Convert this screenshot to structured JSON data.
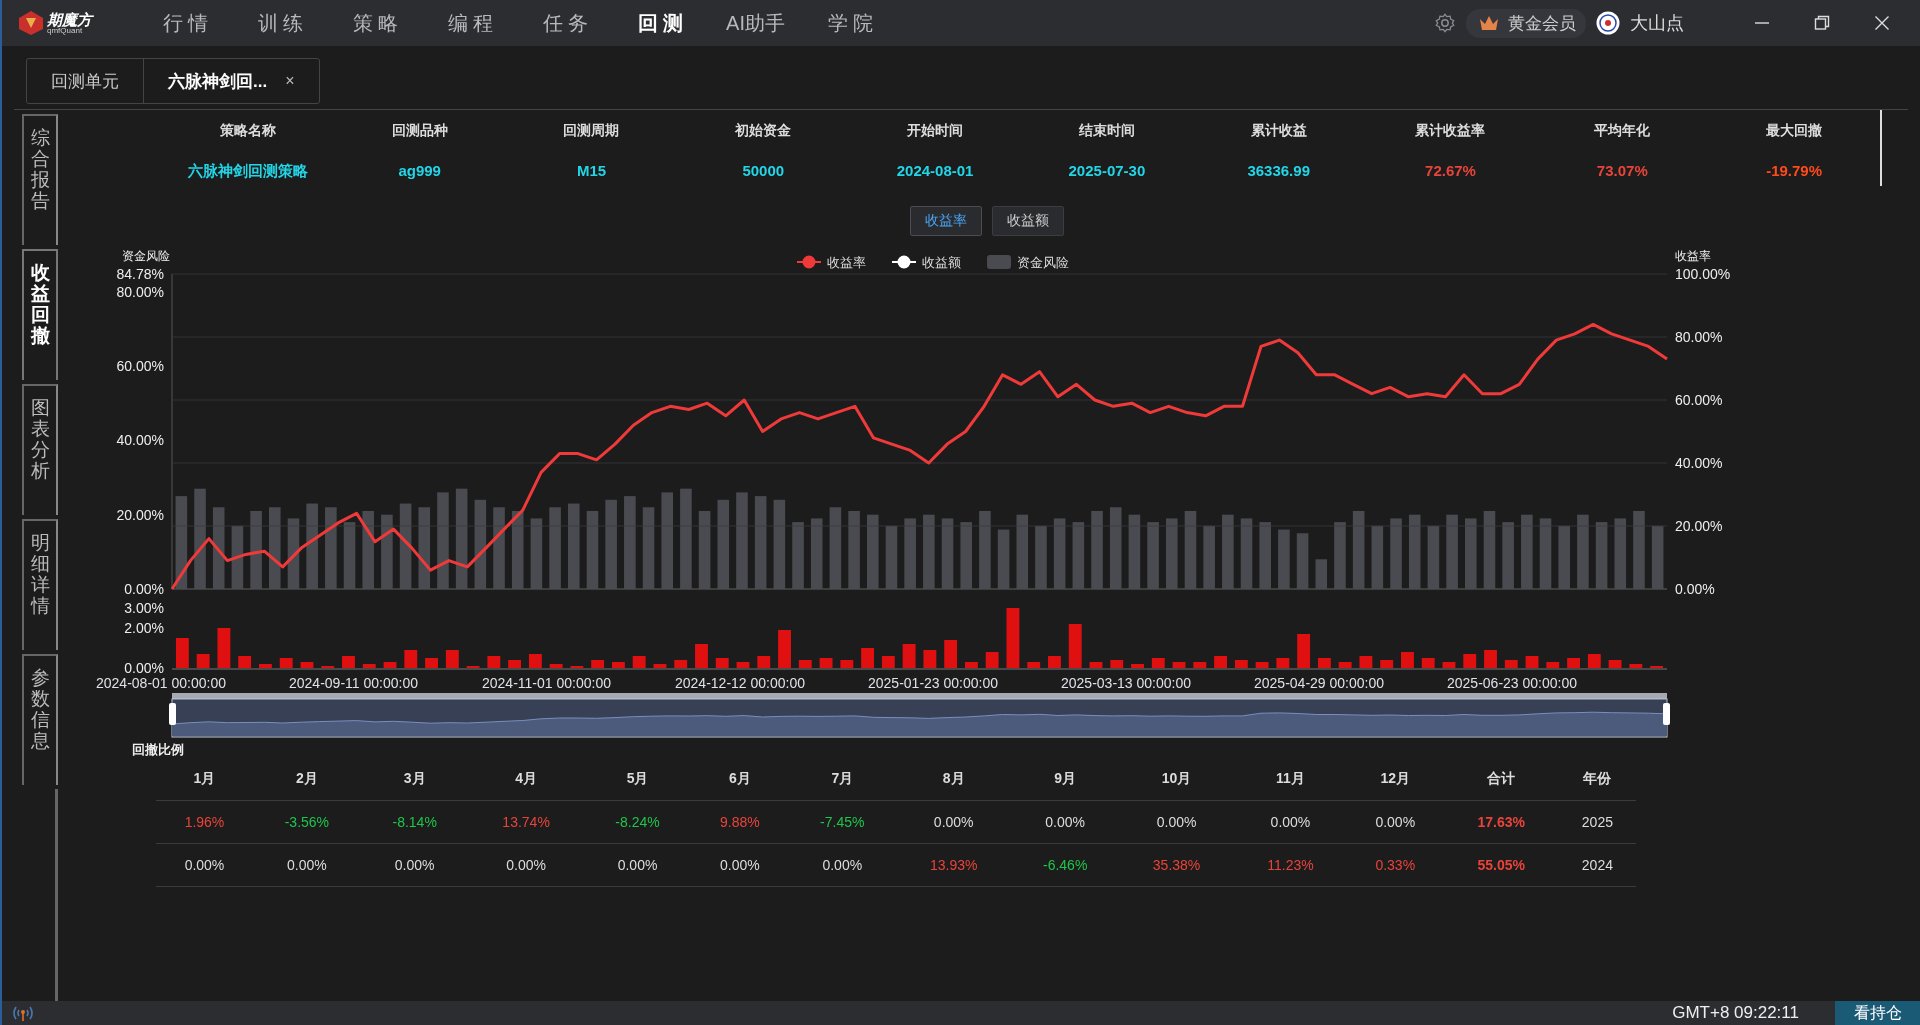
{
  "app": {
    "logo_text": "期魔方",
    "logo_sub": "qmfQuant"
  },
  "nav": [
    {
      "label": "行 情",
      "selected": false
    },
    {
      "label": "训 练",
      "selected": false
    },
    {
      "label": "策 略",
      "selected": false
    },
    {
      "label": "编 程",
      "selected": false
    },
    {
      "label": "任 务",
      "selected": false
    },
    {
      "label": "回 测",
      "selected": true
    },
    {
      "label": "AI助手",
      "selected": false
    },
    {
      "label": "学 院",
      "selected": false
    }
  ],
  "user": {
    "membership": "黄金会员",
    "name": "大山点"
  },
  "doc_tabs": [
    {
      "label": "回测单元",
      "selected": false
    },
    {
      "label": "六脉神剑回...",
      "selected": true,
      "close": "×"
    }
  ],
  "side_tabs": [
    {
      "label": "综合报告",
      "selected": false
    },
    {
      "label": "收益回撤",
      "selected": true
    },
    {
      "label": "图表分析",
      "selected": false
    },
    {
      "label": "明细详情",
      "selected": false
    },
    {
      "label": "参数信息",
      "selected": false
    }
  ],
  "summary": [
    {
      "label": "策略名称",
      "value": "六脉神剑回测策略",
      "color": "#22d6e8"
    },
    {
      "label": "回测品种",
      "value": "ag999",
      "color": "#22d6e8"
    },
    {
      "label": "回测周期",
      "value": "M15",
      "color": "#22d6e8"
    },
    {
      "label": "初始资金",
      "value": "50000",
      "color": "#22d6e8"
    },
    {
      "label": "开始时间",
      "value": "2024-08-01",
      "color": "#22d6e8"
    },
    {
      "label": "结束时间",
      "value": "2025-07-30",
      "color": "#22d6e8"
    },
    {
      "label": "累计收益",
      "value": "36336.99",
      "color": "#22d6e8"
    },
    {
      "label": "累计收益率",
      "value": "72.67%",
      "color": "#e8443a"
    },
    {
      "label": "平均年化",
      "value": "73.07%",
      "color": "#e8443a"
    },
    {
      "label": "最大回撤",
      "value": "-19.79%",
      "color": "#ff4a1c"
    }
  ],
  "toggles": [
    {
      "label": "收益率",
      "selected": true
    },
    {
      "label": "收益额",
      "selected": false
    }
  ],
  "legend_extra": [
    {
      "label": "收益额",
      "color": "#ffffff"
    }
  ],
  "return_chart": {
    "chart_data": {
      "type": "line",
      "ylabel": "收益率",
      "grid": true,
      "ylim": [
        0,
        100
      ],
      "yticks": [
        {
          "value": 0,
          "label": "0.00%"
        },
        {
          "value": 20,
          "label": "20.00%"
        },
        {
          "value": 40,
          "label": "40.00%"
        },
        {
          "value": 60,
          "label": "60.00%"
        },
        {
          "value": 80,
          "label": "80.00%"
        },
        {
          "value": 100,
          "label": "100.00%"
        }
      ],
      "series": [
        {
          "name": "收益率",
          "color": "#f03a3a",
          "values": [
            0,
            9,
            16,
            9,
            11,
            12,
            7,
            13,
            17,
            21,
            24,
            15,
            19,
            13,
            6,
            9,
            7,
            13,
            19,
            25,
            37,
            43,
            43,
            41,
            46,
            52,
            56,
            58,
            57,
            59,
            55,
            60,
            50,
            54,
            56,
            54,
            56,
            58,
            48,
            46,
            44,
            40,
            46,
            50,
            58,
            68,
            65,
            69,
            61,
            65,
            60,
            58,
            59,
            56,
            58,
            56,
            55,
            58,
            58,
            77,
            79,
            75,
            68,
            68,
            65,
            62,
            64,
            61,
            62,
            61,
            68,
            62,
            62,
            65,
            73,
            79,
            81,
            84,
            81,
            79,
            77,
            73
          ]
        }
      ]
    }
  },
  "risk_chart": {
    "chart_data": {
      "type": "bar",
      "ylabel": "资金风险",
      "ylim": [
        0,
        84.78
      ],
      "yticks": [
        {
          "value": 0,
          "label": "0.00%"
        },
        {
          "value": 20,
          "label": "20.00%"
        },
        {
          "value": 40,
          "label": "40.00%"
        },
        {
          "value": 60,
          "label": "60.00%"
        },
        {
          "value": 80,
          "label": "80.00%"
        },
        {
          "value": 84.78,
          "label": "84.78%"
        }
      ],
      "series": [
        {
          "name": "资金风险",
          "color": "#4a4b50",
          "values": [
            25,
            27,
            22,
            17,
            21,
            22,
            19,
            23,
            22,
            18,
            21,
            20,
            23,
            22,
            26,
            27,
            24,
            22,
            21,
            19,
            22,
            23,
            21,
            24,
            25,
            22,
            26,
            27,
            21,
            24,
            26,
            25,
            24,
            18,
            19,
            22,
            21,
            20,
            17,
            19,
            20,
            19,
            18,
            21,
            16,
            20,
            17,
            19,
            18,
            21,
            22,
            20,
            18,
            19,
            21,
            17,
            20,
            19,
            18,
            16,
            15,
            8,
            18,
            21,
            17,
            19,
            20,
            17,
            20,
            19,
            21,
            18,
            20,
            19,
            17,
            20,
            18,
            19,
            21,
            17
          ]
        }
      ]
    }
  },
  "drawdown_chart": {
    "chart_data": {
      "type": "bar",
      "ylim": [
        0,
        3
      ],
      "yticks": [
        {
          "value": 0,
          "label": "0.00%"
        },
        {
          "value": 2,
          "label": "2.00%"
        },
        {
          "value": 3,
          "label": "3.00%"
        }
      ],
      "series": [
        {
          "color": "#e01010",
          "values": [
            1.5,
            0.7,
            2.0,
            0.6,
            0.2,
            0.5,
            0.3,
            0.1,
            0.6,
            0.2,
            0.3,
            0.9,
            0.5,
            0.9,
            0.1,
            0.6,
            0.4,
            0.7,
            0.2,
            0.1,
            0.4,
            0.3,
            0.6,
            0.2,
            0.4,
            1.2,
            0.5,
            0.3,
            0.6,
            1.9,
            0.4,
            0.5,
            0.4,
            1.0,
            0.6,
            1.2,
            0.9,
            1.4,
            0.3,
            0.8,
            3.0,
            0.3,
            0.6,
            2.2,
            0.3,
            0.4,
            0.2,
            0.5,
            0.3,
            0.3,
            0.6,
            0.4,
            0.3,
            0.5,
            1.7,
            0.5,
            0.3,
            0.6,
            0.4,
            0.8,
            0.5,
            0.3,
            0.7,
            0.9,
            0.4,
            0.6,
            0.3,
            0.5,
            0.7,
            0.4,
            0.2,
            0.1
          ]
        }
      ]
    }
  },
  "slider": {
    "level": 1,
    "dates": [
      "2024-08-01 00:00:00",
      "2024-09-11 00:00:00",
      "2024-11-01 00:00:00",
      "2024-12-12 00:00:00",
      "2025-01-23 00:00:00",
      "2025-03-13 00:00:00",
      "2025-04-29 00:00:00",
      "2025-06-23 00:00:00"
    ],
    "label": "回撤比例"
  },
  "monthly": {
    "columns": [
      "1月",
      "2月",
      "3月",
      "4月",
      "5月",
      "6月",
      "7月",
      "8月",
      "9月",
      "10月",
      "11月",
      "12月",
      "合计",
      "年份"
    ],
    "rows": [
      {
        "cells": [
          {
            "text": "1.96%",
            "color": "#e8443a"
          },
          {
            "text": "-3.56%",
            "color": "#1fc44a"
          },
          {
            "text": "-8.14%",
            "color": "#1fc44a"
          },
          {
            "text": "13.74%",
            "color": "#e8443a"
          },
          {
            "text": "-8.24%",
            "color": "#1fc44a"
          },
          {
            "text": "9.88%",
            "color": "#e8443a"
          },
          {
            "text": "-7.45%",
            "color": "#1fc44a"
          },
          {
            "text": "0.00%",
            "color": "#dddddd"
          },
          {
            "text": "0.00%",
            "color": "#dddddd"
          },
          {
            "text": "0.00%",
            "color": "#dddddd"
          },
          {
            "text": "0.00%",
            "color": "#dddddd"
          },
          {
            "text": "0.00%",
            "color": "#dddddd"
          }
        ],
        "total": "17.63%",
        "year": "2025"
      },
      {
        "cells": [
          {
            "text": "0.00%",
            "color": "#dddddd"
          },
          {
            "text": "0.00%",
            "color": "#dddddd"
          },
          {
            "text": "0.00%",
            "color": "#dddddd"
          },
          {
            "text": "0.00%",
            "color": "#dddddd"
          },
          {
            "text": "0.00%",
            "color": "#dddddd"
          },
          {
            "text": "0.00%",
            "color": "#dddddd"
          },
          {
            "text": "0.00%",
            "color": "#dddddd"
          },
          {
            "text": "13.93%",
            "color": "#e8443a"
          },
          {
            "text": "-6.46%",
            "color": "#1fc44a"
          },
          {
            "text": "35.38%",
            "color": "#e8443a"
          },
          {
            "text": "11.23%",
            "color": "#e8443a"
          },
          {
            "text": "0.33%",
            "color": "#e8443a"
          }
        ],
        "total": "55.05%",
        "year": "2024"
      }
    ]
  },
  "status_bar": {
    "clock": "GMT+8 09:22:11",
    "button": "看持仓"
  }
}
